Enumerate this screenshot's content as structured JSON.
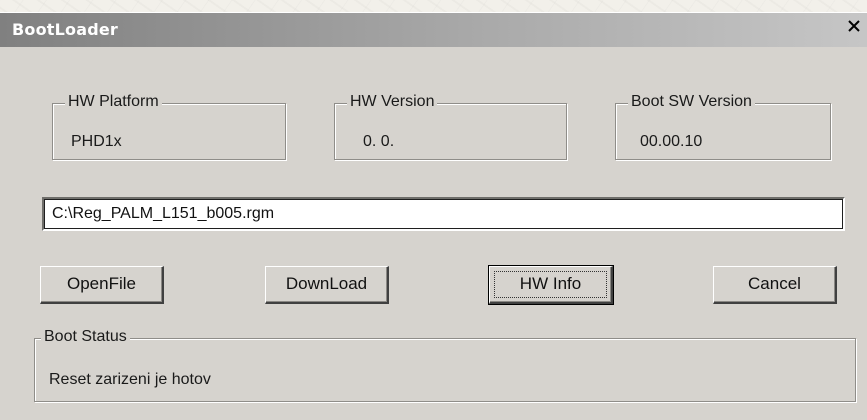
{
  "window": {
    "title": "BootLoader",
    "close_label": "x"
  },
  "groups": {
    "hw_platform": {
      "label": "HW Platform",
      "value": "PHD1x"
    },
    "hw_version": {
      "label": "HW Version",
      "value": "0. 0."
    },
    "boot_sw_version": {
      "label": "Boot SW Version",
      "value": "00.00.10"
    }
  },
  "file_path": {
    "value": "C:\\Reg_PALM_L151_b005.rgm"
  },
  "buttons": {
    "open_file": "OpenFile",
    "download": "DownLoad",
    "hw_info": "HW Info",
    "cancel": "Cancel"
  },
  "boot_status": {
    "label": "Boot Status",
    "value": "Reset zarizeni je hotov"
  }
}
